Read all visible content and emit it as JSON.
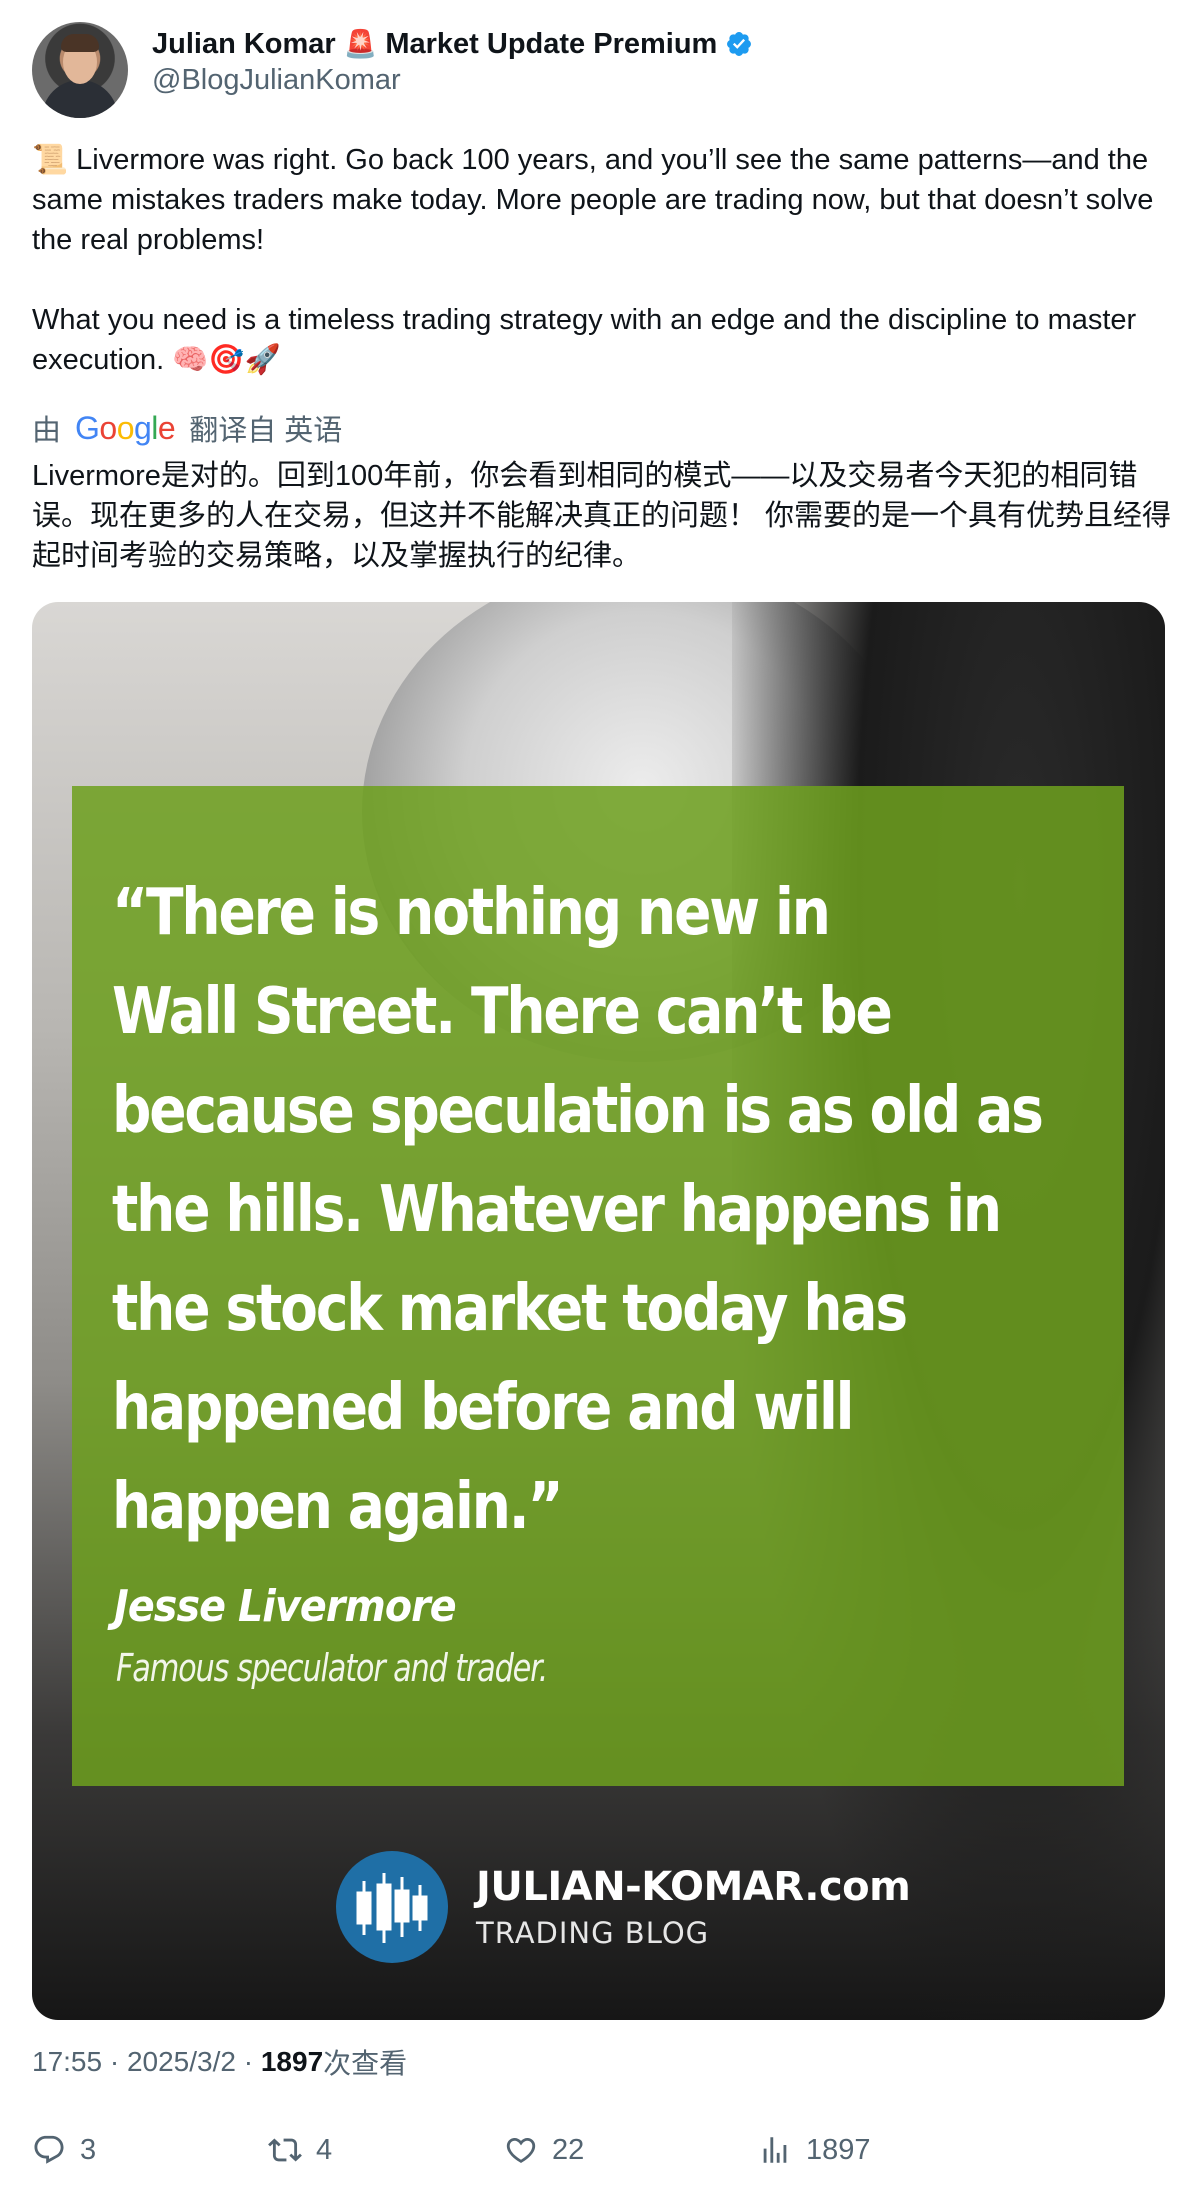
{
  "author": {
    "display_name": "Julian Komar",
    "siren_emoji": "🚨",
    "name_suffix": "Market Update Premium",
    "handle": "@BlogJulianKomar",
    "verified": true
  },
  "tweet": {
    "paragraph1": "📜 Livermore was right. Go back 100 years, and you’ll see the same patterns—and the same mistakes traders make today. More people are trading now, but that doesn’t solve the real problems!",
    "paragraph2": "What you need is a timeless trading strategy with an edge and the discipline to master execution. 🧠🎯🚀"
  },
  "translation": {
    "by": "由",
    "provider": "Google",
    "label": "翻译自 英语",
    "text": "Livermore是对的。回到100年前，你会看到相同的模式——以及交易者今天犯的相同错误。现在更多的人在交易，但这并不能解决真正的问题！ 你需要的是一个具有优势且经得起时间考验的交易策略，以及掌握执行的纪律。"
  },
  "media": {
    "quote_line1": "“There is nothing new in",
    "quote_line2": "Wall Street. There can’t be",
    "quote_line3": "because speculation is as old as",
    "quote_line4": "the hills. Whatever happens in",
    "quote_line5": "the stock market today has",
    "quote_line6": "happened before and will",
    "quote_line7": "happen again.”",
    "quote_author": "Jesse Livermore",
    "quote_role": "Famous speculator and trader.",
    "brand_site": "JULIAN-KOMAR.com",
    "brand_sub": "TRADING BLOG",
    "quote_box_color": "#6ea01e"
  },
  "meta": {
    "time": "17:55",
    "sep1": " · ",
    "date": "2025/3/2",
    "sep2": " · ",
    "views": "1897",
    "views_label": "次查看"
  },
  "actions": {
    "replies": "3",
    "reposts": "4",
    "likes": "22",
    "views": "1897"
  },
  "colors": {
    "verified": "#1d9bf0",
    "secondary_text": "#536471"
  }
}
